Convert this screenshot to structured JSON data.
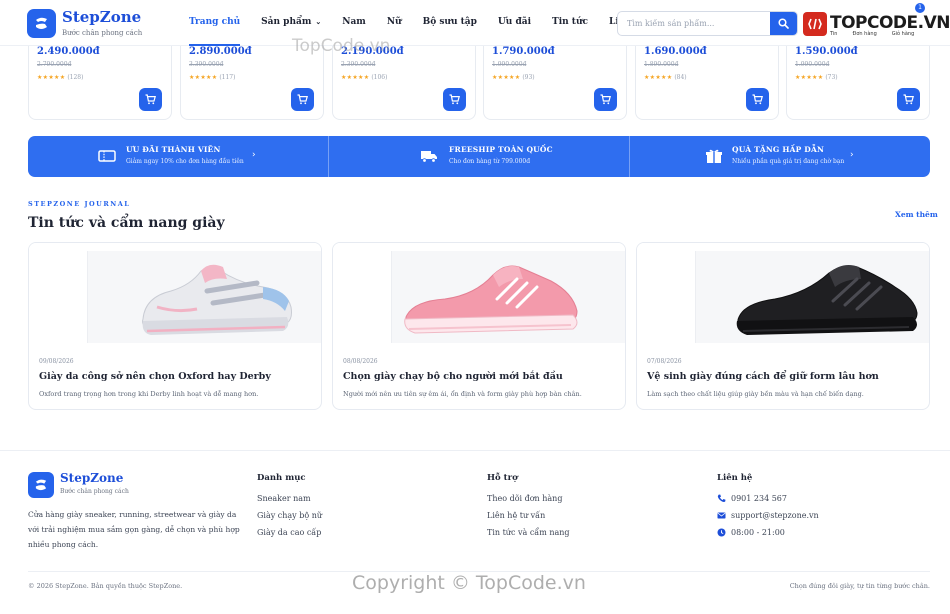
{
  "header": {
    "brand": "StepZone",
    "tagline": "Bước chân phong cách",
    "nav": [
      {
        "label": "Trang chủ",
        "active": true
      },
      {
        "label": "Sản phẩm",
        "dropdown": true
      },
      {
        "label": "Nam"
      },
      {
        "label": "Nữ"
      },
      {
        "label": "Bộ sưu tập"
      },
      {
        "label": "Ưu đãi"
      },
      {
        "label": "Tin tức"
      },
      {
        "label": "Liên hệ"
      }
    ],
    "search_placeholder": "Tìm kiếm sản phẩm...",
    "partner": {
      "logo_text": "TOPCODE.VN",
      "sub_items": [
        "Tin",
        "Đơn hàng",
        "Giỏ hàng"
      ],
      "cart_count": "1"
    }
  },
  "products": [
    {
      "price": "2.490.000đ",
      "old_price": "2.790.000đ",
      "stars": "★★★★★",
      "reviews": "(128)"
    },
    {
      "price": "2.890.000đ",
      "old_price": "3.390.000đ",
      "stars": "★★★★★",
      "reviews": "(117)"
    },
    {
      "price": "2.190.000đ",
      "old_price": "2.390.000đ",
      "stars": "★★★★★",
      "reviews": "(106)"
    },
    {
      "price": "1.790.000đ",
      "old_price": "1.990.000đ",
      "stars": "★★★★★",
      "reviews": "(93)"
    },
    {
      "price": "1.690.000đ",
      "old_price": "1.890.000đ",
      "stars": "★★★★★",
      "reviews": "(84)"
    },
    {
      "price": "1.590.000đ",
      "old_price": "1.990.000đ",
      "stars": "★★★★★",
      "reviews": "(73)"
    }
  ],
  "benefits": [
    {
      "icon": "ticket-icon",
      "title": "Ưu đãi thành viên",
      "desc": "Giảm ngay 10% cho đơn hàng đầu tiên"
    },
    {
      "icon": "truck-icon",
      "title": "Freeship toàn quốc",
      "desc": "Cho đơn hàng từ 799.000đ"
    },
    {
      "icon": "gift-icon",
      "title": "Quà tặng hấp dẫn",
      "desc": "Nhiều phần quà giá trị đang chờ bạn"
    }
  ],
  "journal": {
    "kicker": "STEPZONE JOURNAL",
    "title": "Tin tức và cẩm nang giày",
    "see_more": "Xem thêm",
    "articles": [
      {
        "date": "09/08/2026",
        "title": "Giày da công sở nên chọn Oxford hay Derby",
        "excerpt": "Oxford trang trọng hơn trong khi Derby linh hoạt và dễ mang hơn.",
        "image": "white-pink-velcro-sneaker"
      },
      {
        "date": "08/08/2026",
        "title": "Chọn giày chạy bộ cho người mới bắt đầu",
        "excerpt": "Người mới nên ưu tiên sự êm ái, ổn định và form giày phù hợp bàn chân.",
        "image": "pink-running-shoe"
      },
      {
        "date": "07/08/2026",
        "title": "Vệ sinh giày đúng cách để giữ form lâu hơn",
        "excerpt": "Làm sạch theo chất liệu giúp giày bền màu và hạn chế biến dạng.",
        "image": "black-running-shoe"
      }
    ]
  },
  "footer": {
    "brand": "StepZone",
    "tagline": "Bước chân phong cách",
    "about": "Cửa hàng giày sneaker, running, streetwear và giày da với trải nghiệm mua sắm gọn gàng, dễ chọn và phù hợp nhiều phong cách.",
    "columns": {
      "categories": {
        "heading": "Danh mục",
        "links": [
          "Sneaker nam",
          "Giày chạy bộ nữ",
          "Giày da cao cấp"
        ]
      },
      "support": {
        "heading": "Hỗ trợ",
        "links": [
          "Theo dõi đơn hàng",
          "Liên hệ tư vấn",
          "Tin tức và cẩm nang"
        ]
      },
      "contact": {
        "heading": "Liên hệ",
        "phone": "0901 234 567",
        "email": "support@stepzone.vn",
        "hours": "08:00 - 21:00"
      }
    },
    "copyright": "© 2026 StepZone. Bản quyền thuộc StepZone.",
    "slogan": "Chọn đúng đôi giày, tự tin từng bước chân."
  },
  "watermark": {
    "top": "TopCode.vn",
    "bottom": "Copyright © TopCode.vn"
  },
  "colors": {
    "accent": "#2563eb",
    "benefit_bar": "#2f6ef0",
    "star": "#f5a524",
    "partner_red": "#d42a1e"
  }
}
